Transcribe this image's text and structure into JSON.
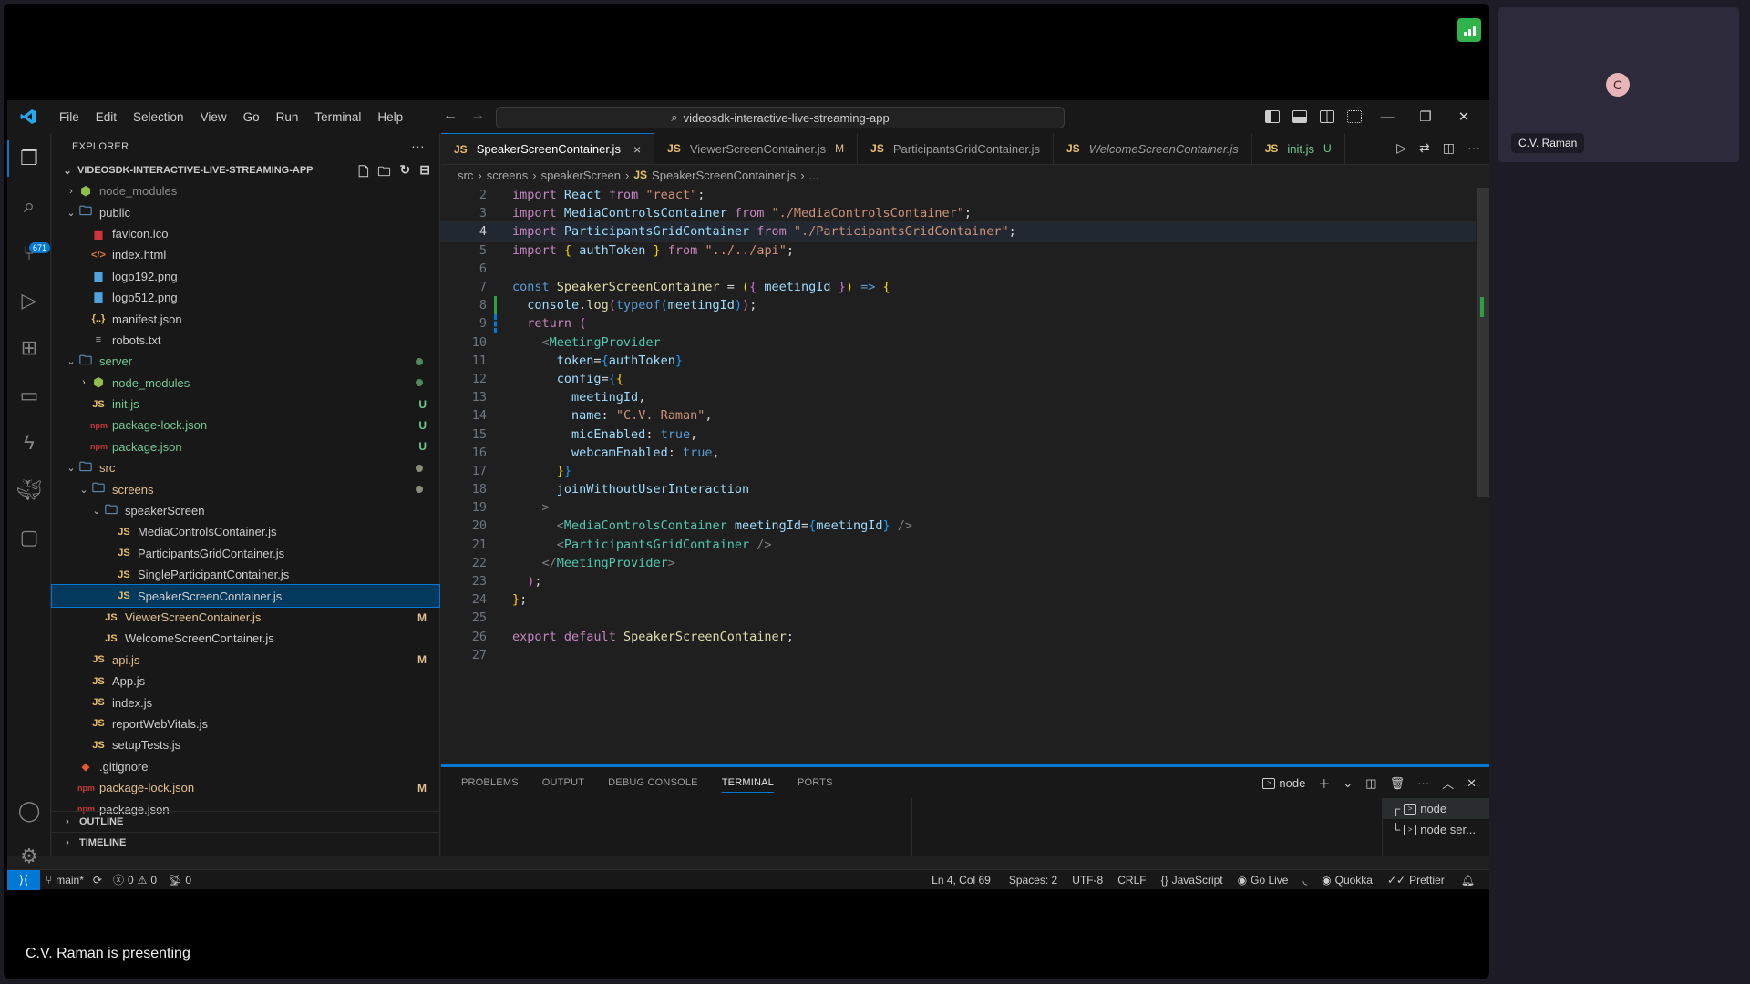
{
  "meeting": {
    "presenting_text": "C.V. Raman is presenting",
    "participant": {
      "name": "C.V. Raman",
      "initial": "C",
      "avatar_color": "#e8b4b8"
    },
    "signal_color": "#2fb34a"
  },
  "titlebar": {
    "menu": [
      "File",
      "Edit",
      "Selection",
      "View",
      "Go",
      "Run",
      "Terminal",
      "Help"
    ],
    "search_text": "videosdk-interactive-live-streaming-app"
  },
  "activity_bar": {
    "scm_badge": "671"
  },
  "explorer": {
    "title": "EXPLORER",
    "project": "VIDEOSDK-INTERACTIVE-LIVE-STREAMING-APP",
    "tree": [
      {
        "name": "node_modules",
        "icon": "node-folder-icon",
        "depth": 0,
        "chev": "right",
        "cls": "c-dim"
      },
      {
        "name": "public",
        "icon": "folder-icon",
        "depth": 0,
        "chev": "down"
      },
      {
        "name": "favicon.ico",
        "icon": "favicon-icon",
        "depth": 1
      },
      {
        "name": "index.html",
        "icon": "html-icon",
        "depth": 1
      },
      {
        "name": "logo192.png",
        "icon": "image-icon",
        "depth": 1
      },
      {
        "name": "logo512.png",
        "icon": "image-icon",
        "depth": 1
      },
      {
        "name": "manifest.json",
        "icon": "json-icon",
        "depth": 1
      },
      {
        "name": "robots.txt",
        "icon": "text-file-icon",
        "depth": 1
      },
      {
        "name": "server",
        "icon": "folder-icon",
        "depth": 0,
        "chev": "down",
        "cls": "c-green",
        "status_dot": "#4e8c5e"
      },
      {
        "name": "node_modules",
        "icon": "node-folder-icon",
        "depth": 1,
        "chev": "right",
        "cls": "c-green",
        "status_dot": "#4e8c5e"
      },
      {
        "name": "init.js",
        "icon": "js-icon",
        "depth": 1,
        "cls": "c-green",
        "status": "U"
      },
      {
        "name": "package-lock.json",
        "icon": "npm-icon",
        "depth": 1,
        "cls": "c-green",
        "status": "U"
      },
      {
        "name": "package.json",
        "icon": "npm-icon",
        "depth": 1,
        "cls": "c-green",
        "status": "U"
      },
      {
        "name": "src",
        "icon": "folder-icon",
        "depth": 0,
        "chev": "down",
        "cls": "c-mod",
        "status_dot": "#8b8b7a"
      },
      {
        "name": "screens",
        "icon": "folder-icon",
        "depth": 1,
        "chev": "down",
        "cls": "c-mod",
        "status_dot": "#8b8b7a"
      },
      {
        "name": "speakerScreen",
        "icon": "folder-icon",
        "depth": 2,
        "chev": "down"
      },
      {
        "name": "MediaControlsContainer.js",
        "icon": "js-icon",
        "depth": 3
      },
      {
        "name": "ParticipantsGridContainer.js",
        "icon": "js-icon",
        "depth": 3
      },
      {
        "name": "SingleParticipantContainer.js",
        "icon": "js-icon",
        "depth": 3
      },
      {
        "name": "SpeakerScreenContainer.js",
        "icon": "js-icon",
        "depth": 3,
        "selected": true
      },
      {
        "name": "ViewerScreenContainer.js",
        "icon": "js-icon",
        "depth": 2,
        "cls": "c-mod",
        "status": "M"
      },
      {
        "name": "WelcomeScreenContainer.js",
        "icon": "js-icon",
        "depth": 2
      },
      {
        "name": "api.js",
        "icon": "js-icon",
        "depth": 1,
        "cls": "c-mod",
        "status": "M"
      },
      {
        "name": "App.js",
        "icon": "js-icon",
        "depth": 1
      },
      {
        "name": "index.js",
        "icon": "js-icon",
        "depth": 1
      },
      {
        "name": "reportWebVitals.js",
        "icon": "js-icon",
        "depth": 1
      },
      {
        "name": "setupTests.js",
        "icon": "js-icon",
        "depth": 1
      },
      {
        "name": ".gitignore",
        "icon": "git-icon",
        "depth": 0
      },
      {
        "name": "package-lock.json",
        "icon": "npm-icon",
        "depth": 0,
        "cls": "c-mod",
        "status": "M"
      },
      {
        "name": "package.json",
        "icon": "npm-icon",
        "depth": 0
      }
    ],
    "outline_label": "OUTLINE",
    "timeline_label": "TIMELINE"
  },
  "editor": {
    "tabs": [
      {
        "name": "SpeakerScreenContainer.js",
        "active": true,
        "close": "×"
      },
      {
        "name": "ViewerScreenContainer.js",
        "badge": "M",
        "badge_color": "#e2c08d"
      },
      {
        "name": "ParticipantsGridContainer.js"
      },
      {
        "name": "WelcomeScreenContainer.js",
        "italic": true
      },
      {
        "name": "init.js",
        "badge": "U",
        "badge_color": "#73c991",
        "name_color": "#73c991"
      }
    ],
    "breadcrumb": [
      "src",
      "screens",
      "speakerScreen",
      "SpeakerScreenContainer.js",
      "..."
    ],
    "current_line": 4,
    "lines": [
      {
        "n": 2,
        "tokens": [
          [
            "k",
            "import"
          ],
          [
            "w",
            " "
          ],
          [
            "v",
            "React"
          ],
          [
            "w",
            " "
          ],
          [
            "k",
            "from"
          ],
          [
            "w",
            " "
          ],
          [
            "s",
            "\"react\""
          ],
          [
            "w",
            ";"
          ]
        ]
      },
      {
        "n": 3,
        "tokens": [
          [
            "k",
            "import"
          ],
          [
            "w",
            " "
          ],
          [
            "v",
            "MediaControlsContainer"
          ],
          [
            "w",
            " "
          ],
          [
            "k",
            "from"
          ],
          [
            "w",
            " "
          ],
          [
            "s",
            "\"./MediaControlsContainer\""
          ],
          [
            "w",
            ";"
          ]
        ]
      },
      {
        "n": 4,
        "tokens": [
          [
            "k",
            "import"
          ],
          [
            "w",
            " "
          ],
          [
            "v",
            "ParticipantsGridContainer"
          ],
          [
            "w",
            " "
          ],
          [
            "k",
            "from"
          ],
          [
            "w",
            " "
          ],
          [
            "s",
            "\"./ParticipantsGridContainer\""
          ],
          [
            "w",
            ";"
          ]
        ]
      },
      {
        "n": 5,
        "tokens": [
          [
            "k",
            "import"
          ],
          [
            "w",
            " "
          ],
          [
            "y",
            "{"
          ],
          [
            "w",
            " "
          ],
          [
            "v",
            "authToken"
          ],
          [
            "w",
            " "
          ],
          [
            "y",
            "}"
          ],
          [
            "w",
            " "
          ],
          [
            "k",
            "from"
          ],
          [
            "w",
            " "
          ],
          [
            "s",
            "\"../../api\""
          ],
          [
            "w",
            ";"
          ]
        ]
      },
      {
        "n": 6,
        "tokens": []
      },
      {
        "n": 7,
        "tokens": [
          [
            "kb",
            "const"
          ],
          [
            "w",
            " "
          ],
          [
            "f",
            "SpeakerScreenContainer"
          ],
          [
            "w",
            " = "
          ],
          [
            "y",
            "("
          ],
          [
            "pu",
            "{"
          ],
          [
            "w",
            " "
          ],
          [
            "v",
            "meetingId"
          ],
          [
            "w",
            " "
          ],
          [
            "pu",
            "}"
          ],
          [
            "y",
            ")"
          ],
          [
            "w",
            " "
          ],
          [
            "kb",
            "=>"
          ],
          [
            "w",
            " "
          ],
          [
            "y",
            "{"
          ]
        ]
      },
      {
        "n": 8,
        "gutter": "add",
        "tokens": [
          [
            "w",
            "  "
          ],
          [
            "v",
            "console"
          ],
          [
            "w",
            "."
          ],
          [
            "f",
            "log"
          ],
          [
            "pu",
            "("
          ],
          [
            "kb",
            "typeof"
          ],
          [
            "bl",
            "("
          ],
          [
            "v",
            "meetingId"
          ],
          [
            "bl",
            ")"
          ],
          [
            "pu",
            ")"
          ],
          [
            "w",
            ";"
          ]
        ]
      },
      {
        "n": 9,
        "gutter": "mod",
        "tokens": [
          [
            "w",
            "  "
          ],
          [
            "k",
            "return"
          ],
          [
            "w",
            " "
          ],
          [
            "pu",
            "("
          ]
        ]
      },
      {
        "n": 10,
        "tokens": [
          [
            "w",
            "    "
          ],
          [
            "p",
            "<"
          ],
          [
            "t",
            "MeetingProvider"
          ]
        ]
      },
      {
        "n": 11,
        "tokens": [
          [
            "w",
            "      "
          ],
          [
            "v",
            "token"
          ],
          [
            "w",
            "="
          ],
          [
            "bl",
            "{"
          ],
          [
            "v",
            "authToken"
          ],
          [
            "bl",
            "}"
          ]
        ]
      },
      {
        "n": 12,
        "tokens": [
          [
            "w",
            "      "
          ],
          [
            "v",
            "config"
          ],
          [
            "w",
            "="
          ],
          [
            "bl",
            "{"
          ],
          [
            "y",
            "{"
          ]
        ]
      },
      {
        "n": 13,
        "tokens": [
          [
            "w",
            "        "
          ],
          [
            "v",
            "meetingId"
          ],
          [
            "w",
            ","
          ]
        ]
      },
      {
        "n": 14,
        "tokens": [
          [
            "w",
            "        "
          ],
          [
            "v",
            "name"
          ],
          [
            "w",
            ": "
          ],
          [
            "s",
            "\"C.V. Raman\""
          ],
          [
            "w",
            ","
          ]
        ]
      },
      {
        "n": 15,
        "tokens": [
          [
            "w",
            "        "
          ],
          [
            "v",
            "micEnabled"
          ],
          [
            "w",
            ": "
          ],
          [
            "kb",
            "true"
          ],
          [
            "w",
            ","
          ]
        ]
      },
      {
        "n": 16,
        "tokens": [
          [
            "w",
            "        "
          ],
          [
            "v",
            "webcamEnabled"
          ],
          [
            "w",
            ": "
          ],
          [
            "kb",
            "true"
          ],
          [
            "w",
            ","
          ]
        ]
      },
      {
        "n": 17,
        "tokens": [
          [
            "w",
            "      "
          ],
          [
            "y",
            "}"
          ],
          [
            "bl",
            "}"
          ]
        ]
      },
      {
        "n": 18,
        "tokens": [
          [
            "w",
            "      "
          ],
          [
            "v",
            "joinWithoutUserInteraction"
          ]
        ]
      },
      {
        "n": 19,
        "tokens": [
          [
            "w",
            "    "
          ],
          [
            "p",
            ">"
          ]
        ]
      },
      {
        "n": 20,
        "tokens": [
          [
            "w",
            "      "
          ],
          [
            "p",
            "<"
          ],
          [
            "t",
            "MediaControlsContainer"
          ],
          [
            "w",
            " "
          ],
          [
            "v",
            "meetingId"
          ],
          [
            "w",
            "="
          ],
          [
            "bl",
            "{"
          ],
          [
            "v",
            "meetingId"
          ],
          [
            "bl",
            "}"
          ],
          [
            "w",
            " "
          ],
          [
            "p",
            "/>"
          ]
        ]
      },
      {
        "n": 21,
        "tokens": [
          [
            "w",
            "      "
          ],
          [
            "p",
            "<"
          ],
          [
            "t",
            "ParticipantsGridContainer"
          ],
          [
            "w",
            " "
          ],
          [
            "p",
            "/>"
          ]
        ]
      },
      {
        "n": 22,
        "tokens": [
          [
            "w",
            "    "
          ],
          [
            "p",
            "</"
          ],
          [
            "t",
            "MeetingProvider"
          ],
          [
            "p",
            ">"
          ]
        ]
      },
      {
        "n": 23,
        "tokens": [
          [
            "w",
            "  "
          ],
          [
            "pu",
            ")"
          ],
          [
            "w",
            ";"
          ]
        ]
      },
      {
        "n": 24,
        "tokens": [
          [
            "y",
            "}"
          ],
          [
            "w",
            ";"
          ]
        ]
      },
      {
        "n": 25,
        "tokens": []
      },
      {
        "n": 26,
        "tokens": [
          [
            "k",
            "export"
          ],
          [
            "w",
            " "
          ],
          [
            "k",
            "default"
          ],
          [
            "w",
            " "
          ],
          [
            "f",
            "SpeakerScreenContainer"
          ],
          [
            "w",
            ";"
          ]
        ]
      },
      {
        "n": 27,
        "tokens": []
      }
    ]
  },
  "panel": {
    "tabs": [
      "PROBLEMS",
      "OUTPUT",
      "DEBUG CONSOLE",
      "TERMINAL",
      "PORTS"
    ],
    "active_tab": "TERMINAL",
    "terminal_label": "node",
    "terminals": [
      {
        "name": "node",
        "prefix": "┌"
      },
      {
        "name": "node ser...",
        "prefix": "└"
      }
    ]
  },
  "statusbar": {
    "branch": "main*",
    "errors": "0",
    "warnings": "0",
    "ports": "0",
    "position": "Ln 4, Col 69",
    "spaces": "Spaces: 2",
    "encoding": "UTF-8",
    "eol": "CRLF",
    "language": "JavaScript",
    "go_live": "Go Live",
    "quokka": "Quokka",
    "prettier": "Prettier"
  }
}
